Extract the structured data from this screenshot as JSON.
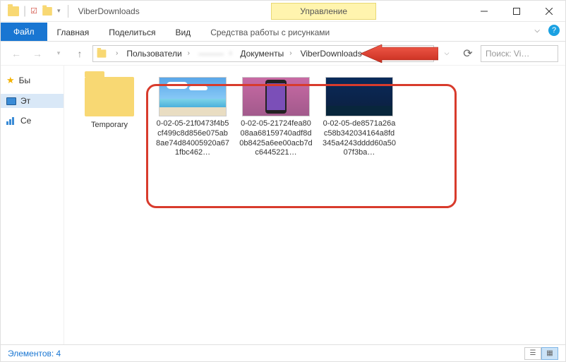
{
  "title": {
    "app": "ViberDownloads"
  },
  "ribbon": {
    "contextual_tab_group": "Управление",
    "file": "Файл",
    "tabs": [
      "Главная",
      "Поделиться",
      "Вид"
    ],
    "context_tab": "Средства работы с рисунками"
  },
  "breadcrumb": {
    "items": [
      "Пользователи",
      "———",
      "Документы",
      "ViberDownloads"
    ]
  },
  "search": {
    "placeholder": "Поиск: Vi…"
  },
  "sidebar": {
    "items": [
      {
        "label": "Бы",
        "icon": "star"
      },
      {
        "label": "Эт",
        "icon": "pc"
      },
      {
        "label": "Се",
        "icon": "net"
      }
    ],
    "selected": 1
  },
  "content": {
    "folder": {
      "name": "Temporary"
    },
    "files": [
      {
        "name": "0-02-05-21f0473f4b5cf499c8d856e075ab8ae74d84005920a671fbc462…"
      },
      {
        "name": "0-02-05-21724fea8008aa68159740adf8d0b8425a6ee00acb7dc6445221…"
      },
      {
        "name": "0-02-05-de8571a26ac58b342034164a8fd345a4243dddd60a5007f3ba…"
      }
    ]
  },
  "status": {
    "count_label": "Элементов: 4"
  }
}
